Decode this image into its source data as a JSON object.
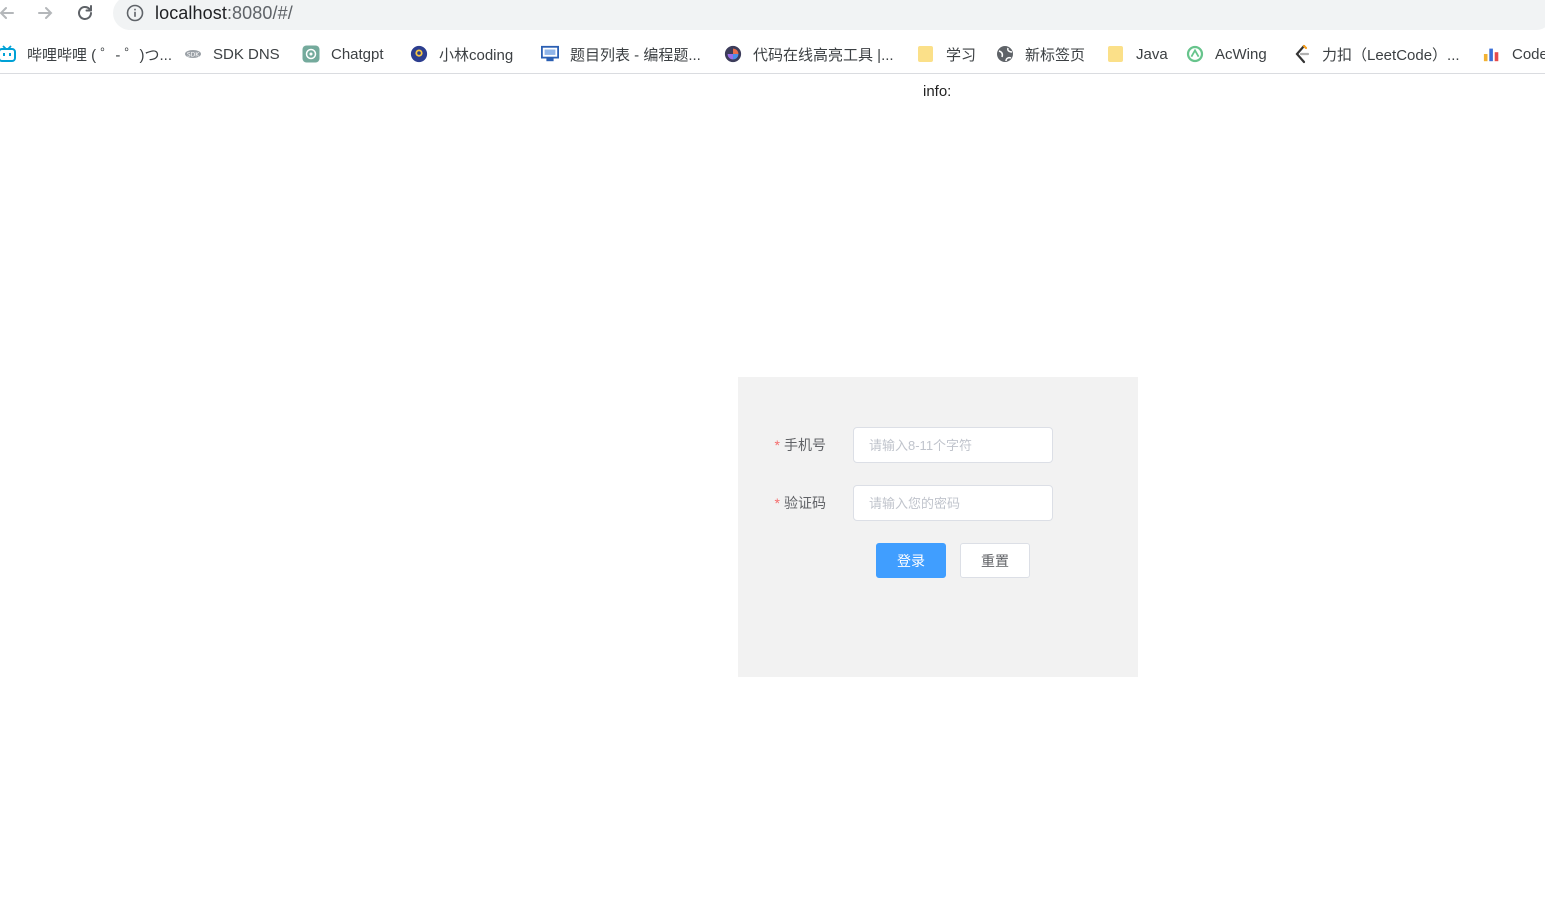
{
  "browser": {
    "url_host": "localhost",
    "url_path": ":8080/#/"
  },
  "bookmarks": [
    {
      "label": "哔哩哔哩 ( ゜- ゜)つ...",
      "icon": "bilibili-icon"
    },
    {
      "label": "SDK DNS",
      "icon": "sdk-icon"
    },
    {
      "label": "Chatgpt",
      "icon": "chatgpt-icon"
    },
    {
      "label": "小林coding",
      "icon": "xiaolin-icon"
    },
    {
      "label": "题目列表 - 编程题...",
      "icon": "problem-list-icon"
    },
    {
      "label": "代码在线高亮工具 |...",
      "icon": "code-highlight-icon"
    },
    {
      "label": "学习",
      "icon": "folder-icon"
    },
    {
      "label": "新标签页",
      "icon": "globe-icon"
    },
    {
      "label": "Java",
      "icon": "folder-icon"
    },
    {
      "label": "AcWing",
      "icon": "acwing-icon"
    },
    {
      "label": "力扣（LeetCode）...",
      "icon": "leetcode-icon"
    },
    {
      "label": "Code",
      "icon": "bar-chart-icon"
    }
  ],
  "page": {
    "info_text": "info:"
  },
  "login_form": {
    "phone_label": "手机号",
    "phone_placeholder": "请输入8-11个字符",
    "phone_value": "",
    "code_label": "验证码",
    "code_placeholder": "请输入您的密码",
    "code_value": "",
    "required_mark": "*",
    "login_button": "登录",
    "reset_button": "重置"
  },
  "colors": {
    "primary": "#409eff",
    "required": "#f56c6c",
    "panel_bg": "#f2f2f2"
  }
}
